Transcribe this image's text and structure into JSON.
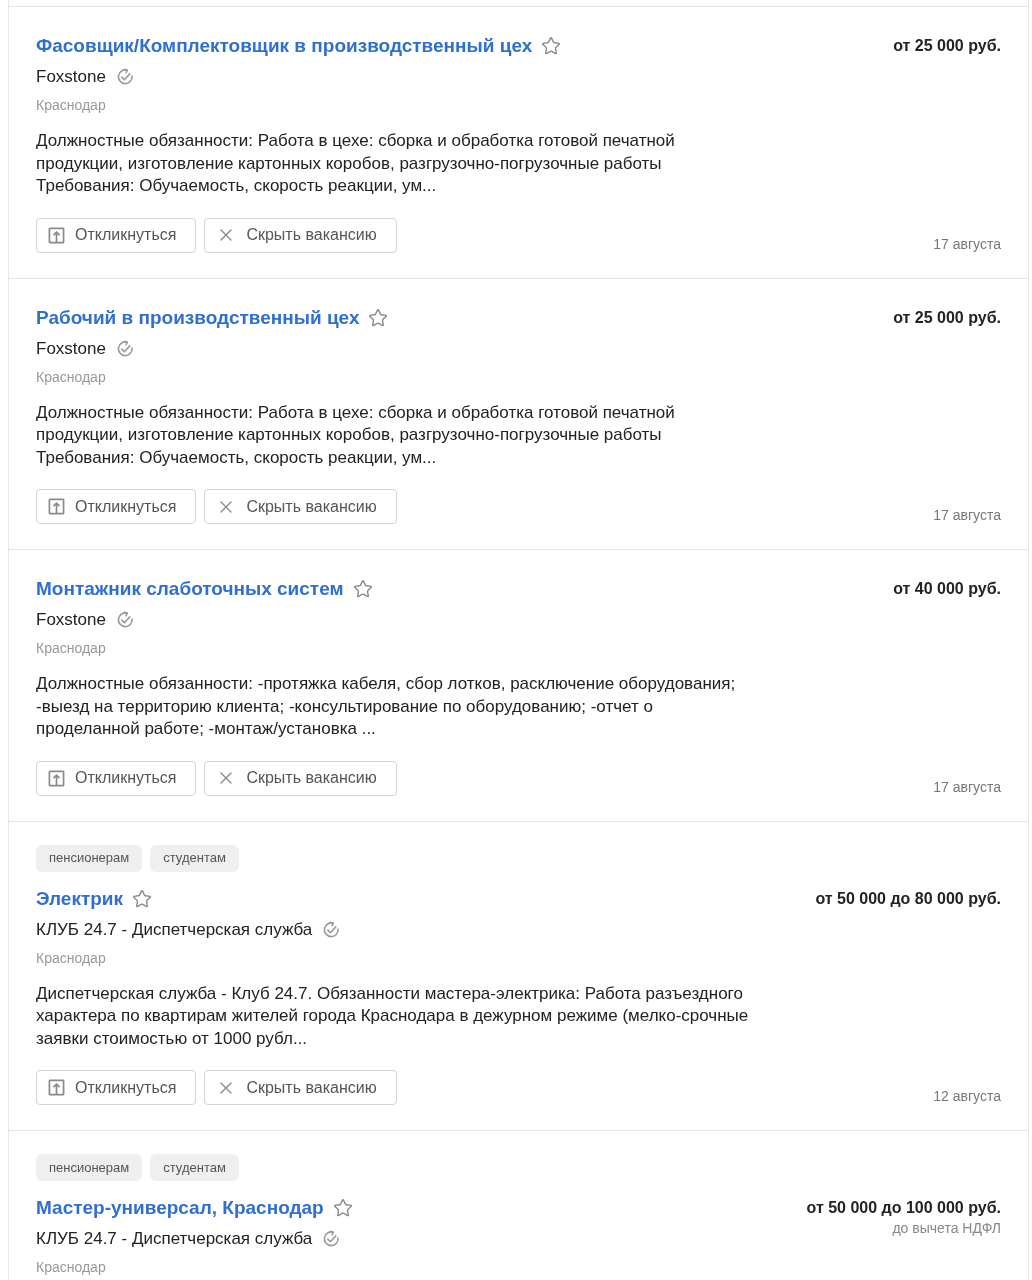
{
  "vacancies": [
    {
      "title": "Фасовщик/Комплектовщик в производственный цех",
      "company": "Foxstone",
      "verified": true,
      "location": "Краснодар",
      "description": "Должностные обязанности: Работа в цехе: сборка и обработка готовой печатной продукции, изготовление картонных коробов, разгрузочно-погрузочные работы Требования: Обучаемость, скорость реакции, ум...",
      "salary": "от 25 000 руб.",
      "actions": [
        {
          "kind": "respond",
          "label": "Откликнуться"
        },
        {
          "kind": "hide",
          "label": "Скрыть вакансию"
        }
      ],
      "date": "17 августа"
    },
    {
      "title": "Рабочий в производственный цех",
      "company": "Foxstone",
      "verified": true,
      "location": "Краснодар",
      "description": "Должностные обязанности: Работа в цехе: сборка и обработка готовой печатной продукции, изготовление картонных коробов, разгрузочно-погрузочные работы Требования: Обучаемость, скорость реакции, ум...",
      "salary": "от 25 000 руб.",
      "actions": [
        {
          "kind": "respond",
          "label": "Откликнуться"
        },
        {
          "kind": "hide",
          "label": "Скрыть вакансию"
        }
      ],
      "date": "17 августа"
    },
    {
      "title": "Монтажник слаботочных систем",
      "company": "Foxstone",
      "verified": true,
      "location": "Краснодар",
      "description": "Должностные обязанности: -протяжка кабеля, сбор лотков, расключение оборудования; -выезд на территорию клиента; -консультирование по оборудованию; -отчет о проделанной работе; -монтаж/установка ...",
      "salary": "от 40 000 руб.",
      "actions": [
        {
          "kind": "respond",
          "label": "Откликнуться"
        },
        {
          "kind": "hide",
          "label": "Скрыть вакансию"
        }
      ],
      "date": "17 августа"
    },
    {
      "tags": [
        "пенсионерам",
        "студентам"
      ],
      "title": "Электрик",
      "company": "КЛУБ 24.7 - Диспетчерская служба",
      "verified": true,
      "location": "Краснодар",
      "description": "Диспетчерская служба - Клуб 24.7. Обязанности мастера-электрика: Работа разъездного характера по квартирам жителей города Краснодара в дежурном режиме (мелко-срочные заявки стоимостью от 1000 рубл...",
      "salary": "от 50 000 до 80 000 руб.",
      "actions": [
        {
          "kind": "respond",
          "label": "Откликнуться"
        },
        {
          "kind": "hide",
          "label": "Скрыть вакансию"
        }
      ],
      "date": "12 августа"
    },
    {
      "tags": [
        "пенсионерам",
        "студентам"
      ],
      "title": "Мастер-универсал, Краснодар",
      "company": "КЛУБ 24.7 - Диспетчерская служба",
      "verified": true,
      "location": "Краснодар",
      "salary": "от 50 000 до 100 000 руб.",
      "salary_note": "до вычета НДФЛ"
    }
  ]
}
